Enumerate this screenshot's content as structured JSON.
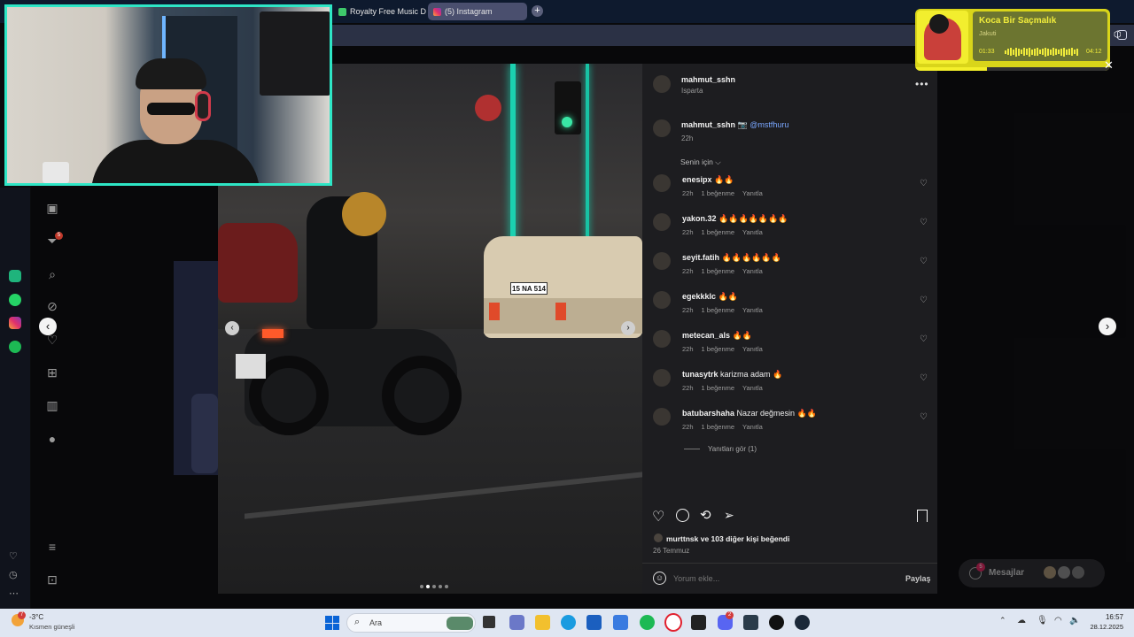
{
  "browser": {
    "tabs": [
      {
        "label": "Royalty Free Music Downl",
        "active": false
      },
      {
        "label": "(5) Instagram",
        "active": true
      }
    ],
    "new_tab_symbol": "+"
  },
  "post": {
    "author": "mahmut_sshn",
    "location": "Isparta",
    "caption_author": "mahmut_sshn",
    "caption_text": "📷 @mstfhuru",
    "caption_time": "22h",
    "sort_label": "Senin için ⌵",
    "comments": [
      {
        "user": "enesipx",
        "text": "🔥🔥",
        "time": "22h",
        "likes": "1 beğenme",
        "reply": "Yanıtla"
      },
      {
        "user": "yakon.32",
        "text": "🔥🔥🔥🔥🔥🔥🔥",
        "time": "22h",
        "likes": "1 beğenme",
        "reply": "Yanıtla"
      },
      {
        "user": "seyit.fatih",
        "text": "🔥🔥🔥🔥🔥🔥",
        "time": "22h",
        "likes": "1 beğenme",
        "reply": "Yanıtla"
      },
      {
        "user": "egekkklc",
        "text": "🔥🔥",
        "time": "22h",
        "likes": "1 beğenme",
        "reply": "Yanıtla"
      },
      {
        "user": "metecan_als",
        "text": "🔥🔥",
        "time": "22h",
        "likes": "1 beğenme",
        "reply": "Yanıtla"
      },
      {
        "user": "tunasytrk",
        "text": "karizma adam 🔥",
        "time": "22h",
        "likes": "1 beğenme",
        "reply": "Yanıtla"
      },
      {
        "user": "batubarshaha",
        "text": "Nazar değmesin 🔥🔥",
        "time": "22h",
        "likes": "1 beğenme",
        "reply": "Yanıtla"
      }
    ],
    "view_replies": "Yanıtları gör (1)",
    "liked_by": "murttnsk ve 103 diğer kişi beğendi",
    "date": "26 Temmuz",
    "comment_placeholder": "Yorum ekle...",
    "share_label": "Paylaş",
    "license_plate": "15 NA 514",
    "carousel": {
      "dots": 5,
      "active": 1
    }
  },
  "messages": {
    "label": "Mesajlar",
    "badge": "5"
  },
  "sidebar_badge": "5",
  "music": {
    "title": "Koca Bir Saçmalık",
    "artist": "Jakuti",
    "elapsed": "01:33",
    "total": "04:12",
    "progress": 0.37
  },
  "taskbar": {
    "weather_temp": "-3°C",
    "weather_desc": "Kısmen güneşli",
    "weather_badge": "7",
    "search_label": "Ara",
    "time": "16:57",
    "date": "28.12.2025",
    "discord_badge": "2"
  },
  "colors": {
    "accent": "#0095f6",
    "panel": "#1d1d20",
    "music": "#d9d51a",
    "cam_border": "#2ee6c6"
  }
}
